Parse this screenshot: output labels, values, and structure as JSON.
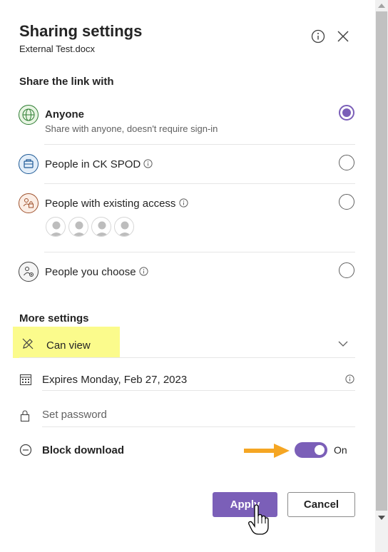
{
  "header": {
    "title": "Sharing settings",
    "file_name": "External Test.docx"
  },
  "share_with": {
    "section_title": "Share the link with",
    "options": [
      {
        "label": "Anyone",
        "description": "Share with anyone, doesn't require sign-in",
        "selected": true,
        "icon": "globe-icon"
      },
      {
        "label": "People in CK SPOD",
        "selected": false,
        "icon": "building-icon"
      },
      {
        "label": "People with existing access",
        "selected": false,
        "icon": "people-lock-icon"
      },
      {
        "label": "People you choose",
        "selected": false,
        "icon": "people-choose-icon"
      }
    ],
    "existing_access_avatar_count": 4
  },
  "more_settings": {
    "section_title": "More settings",
    "permission": "Can view",
    "expires_label": "Expires",
    "expires_date": "Monday, Feb 27, 2023",
    "password_placeholder": "Set password",
    "block_download_label": "Block download",
    "block_download_state": "On",
    "block_download_enabled": true
  },
  "actions": {
    "apply_label": "Apply",
    "cancel_label": "Cancel"
  },
  "colors": {
    "accent": "#7b5fb8",
    "highlight": "#fbfb8c",
    "arrow": "#f5a623"
  }
}
